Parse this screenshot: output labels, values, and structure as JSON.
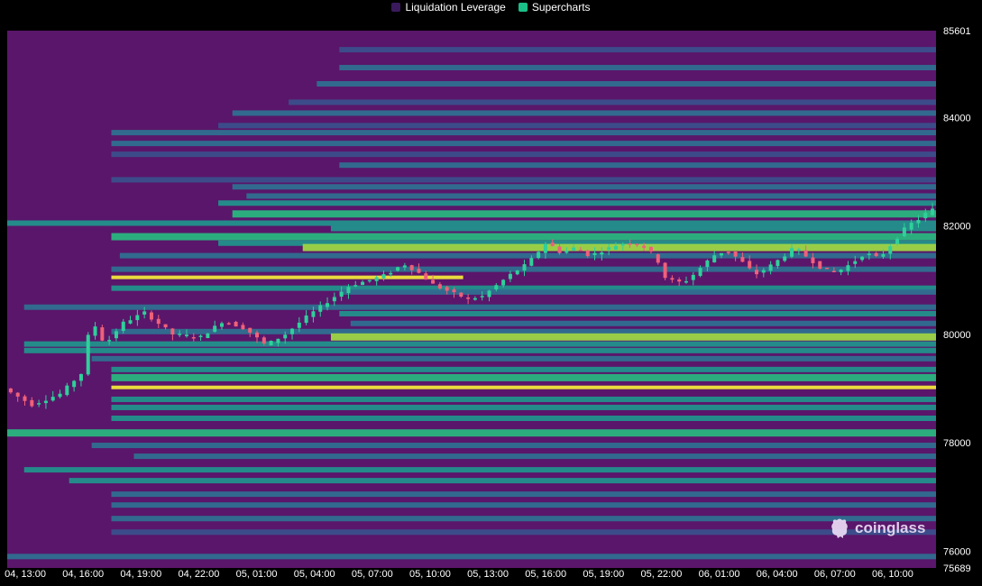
{
  "legend": {
    "items": [
      {
        "label": "Liquidation Leverage",
        "color": "#3a1a5c"
      },
      {
        "label": "Supercharts",
        "color": "#1bbf88"
      }
    ]
  },
  "watermark": {
    "text": "coinglass"
  },
  "colors": {
    "background": "#000000",
    "heatmap_base": "#5a166a",
    "candle_up": "#2fd09a",
    "candle_down": "#f0607a",
    "axis_text": "#ffffff",
    "palette": [
      "#43307a",
      "#3b4f8c",
      "#2f6f90",
      "#22918c",
      "#2ab57f",
      "#9ed646",
      "#f2e63a"
    ]
  },
  "chart_data": {
    "type": "heatmap",
    "title": "",
    "xlabel": "",
    "ylabel": "",
    "x_ticks": [
      "04, 13:00",
      "04, 16:00",
      "04, 19:00",
      "04, 22:00",
      "05, 01:00",
      "05, 04:00",
      "05, 07:00",
      "05, 10:00",
      "05, 13:00",
      "05, 16:00",
      "05, 19:00",
      "05, 22:00",
      "06, 01:00",
      "06, 04:00",
      "06, 07:00",
      "06, 10:00"
    ],
    "x_range_hours": [
      -0.5,
      25.2
    ],
    "y_ticks": [
      75689,
      76000,
      78000,
      80000,
      82000,
      84000,
      85601
    ],
    "ylim": [
      75689,
      85601
    ],
    "liquidation_bands": [
      {
        "price": 85250,
        "start": 11.8,
        "level": 0.2
      },
      {
        "price": 84920,
        "start": 11.8,
        "level": 0.35
      },
      {
        "price": 84620,
        "start": 11.0,
        "level": 0.25
      },
      {
        "price": 84280,
        "start": 10.0,
        "level": 0.18
      },
      {
        "price": 84080,
        "start": 8.0,
        "level": 0.3
      },
      {
        "price": 83850,
        "start": 7.5,
        "level": 0.2
      },
      {
        "price": 83720,
        "start": 3.7,
        "level": 0.25
      },
      {
        "price": 83520,
        "start": 3.7,
        "level": 0.32
      },
      {
        "price": 83320,
        "start": 3.7,
        "level": 0.2
      },
      {
        "price": 83120,
        "start": 11.8,
        "level": 0.3
      },
      {
        "price": 82850,
        "start": 3.7,
        "level": 0.22
      },
      {
        "price": 82720,
        "start": 8.0,
        "level": 0.25
      },
      {
        "price": 82550,
        "start": 8.5,
        "level": 0.3
      },
      {
        "price": 82420,
        "start": 7.5,
        "level": 0.45
      },
      {
        "price": 82220,
        "start": 8.0,
        "level": 0.62
      },
      {
        "price": 82050,
        "start": 0.0,
        "level": 0.42
      },
      {
        "price": 81950,
        "start": 11.5,
        "level": 0.55
      },
      {
        "price": 81800,
        "start": 3.7,
        "level": 0.62
      },
      {
        "price": 81680,
        "start": 7.5,
        "level": 0.48
      },
      {
        "price": 81600,
        "start": 10.5,
        "level": 0.78
      },
      {
        "price": 81450,
        "start": 4.0,
        "level": 0.32
      },
      {
        "price": 81200,
        "start": 3.7,
        "level": 0.38
      },
      {
        "price": 81050,
        "start": 3.7,
        "level": 1.0,
        "end": 16.2
      },
      {
        "price": 80850,
        "start": 3.7,
        "level": 0.48
      },
      {
        "price": 80780,
        "start": 11.8,
        "level": 0.32
      },
      {
        "price": 80500,
        "start": 0.6,
        "level": 0.32
      },
      {
        "price": 80380,
        "start": 11.8,
        "level": 0.42
      },
      {
        "price": 80200,
        "start": 12.2,
        "level": 0.32
      },
      {
        "price": 80050,
        "start": 3.7,
        "level": 0.38
      },
      {
        "price": 79950,
        "start": 11.5,
        "level": 0.82
      },
      {
        "price": 79820,
        "start": 0.6,
        "level": 0.48
      },
      {
        "price": 79700,
        "start": 0.6,
        "level": 0.55
      },
      {
        "price": 79550,
        "start": 3.0,
        "level": 0.38
      },
      {
        "price": 79350,
        "start": 3.7,
        "level": 0.48
      },
      {
        "price": 79200,
        "start": 3.7,
        "level": 0.62
      },
      {
        "price": 79020,
        "start": 3.7,
        "level": 0.92
      },
      {
        "price": 78800,
        "start": 3.7,
        "level": 0.42
      },
      {
        "price": 78650,
        "start": 3.7,
        "level": 0.55
      },
      {
        "price": 78450,
        "start": 3.7,
        "level": 0.42
      },
      {
        "price": 78180,
        "start": 0.0,
        "level": 0.68
      },
      {
        "price": 77950,
        "start": 3.0,
        "level": 0.32
      },
      {
        "price": 77750,
        "start": 4.5,
        "level": 0.38
      },
      {
        "price": 77500,
        "start": 0.6,
        "level": 0.42
      },
      {
        "price": 77300,
        "start": 2.2,
        "level": 0.48
      },
      {
        "price": 77050,
        "start": 3.7,
        "level": 0.38
      },
      {
        "price": 76850,
        "start": 3.7,
        "level": 0.25
      },
      {
        "price": 76600,
        "start": 3.7,
        "level": 0.32
      },
      {
        "price": 76350,
        "start": 3.7,
        "level": 0.22
      },
      {
        "price": 75900,
        "start": 0.0,
        "level": 0.25
      }
    ],
    "price_path": [
      [
        0,
        79000
      ],
      [
        1,
        78700
      ],
      [
        2,
        78900
      ],
      [
        2.8,
        79300
      ],
      [
        3.1,
        80300
      ],
      [
        3.6,
        79800
      ],
      [
        4.2,
        80200
      ],
      [
        5,
        80400
      ],
      [
        6,
        80000
      ],
      [
        7,
        79950
      ],
      [
        7.8,
        80250
      ],
      [
        8.6,
        80100
      ],
      [
        9.3,
        79800
      ],
      [
        10,
        80000
      ],
      [
        10.7,
        80300
      ],
      [
        11.5,
        80600
      ],
      [
        12.3,
        80900
      ],
      [
        13,
        81000
      ],
      [
        13.6,
        81100
      ],
      [
        14.2,
        81300
      ],
      [
        14.7,
        81150
      ],
      [
        15.3,
        80900
      ],
      [
        16,
        80750
      ],
      [
        16.5,
        80650
      ],
      [
        17,
        80700
      ],
      [
        17.5,
        80900
      ],
      [
        18,
        81100
      ],
      [
        18.6,
        81300
      ],
      [
        19.3,
        81700
      ],
      [
        19.8,
        81500
      ],
      [
        20.3,
        81600
      ],
      [
        20.8,
        81450
      ],
      [
        21.3,
        81550
      ],
      [
        21.8,
        81650
      ],
      [
        22.3,
        81700
      ],
      [
        22.8,
        81600
      ],
      [
        23.2,
        81400
      ],
      [
        23.5,
        81050
      ],
      [
        23.9,
        80950
      ],
      [
        24.3,
        81000
      ],
      [
        24.7,
        81200
      ],
      [
        25.2,
        81450
      ],
      [
        25.7,
        81550
      ],
      [
        26.2,
        81350
      ],
      [
        26.7,
        81100
      ],
      [
        27.2,
        81250
      ],
      [
        27.6,
        81400
      ],
      [
        28.1,
        81600
      ],
      [
        28.6,
        81400
      ],
      [
        29.1,
        81200
      ],
      [
        29.6,
        81150
      ],
      [
        30.1,
        81300
      ],
      [
        30.6,
        81500
      ],
      [
        31.1,
        81400
      ],
      [
        31.6,
        81700
      ],
      [
        32.1,
        82000
      ],
      [
        32.6,
        82150
      ],
      [
        32.9,
        82300
      ]
    ]
  }
}
